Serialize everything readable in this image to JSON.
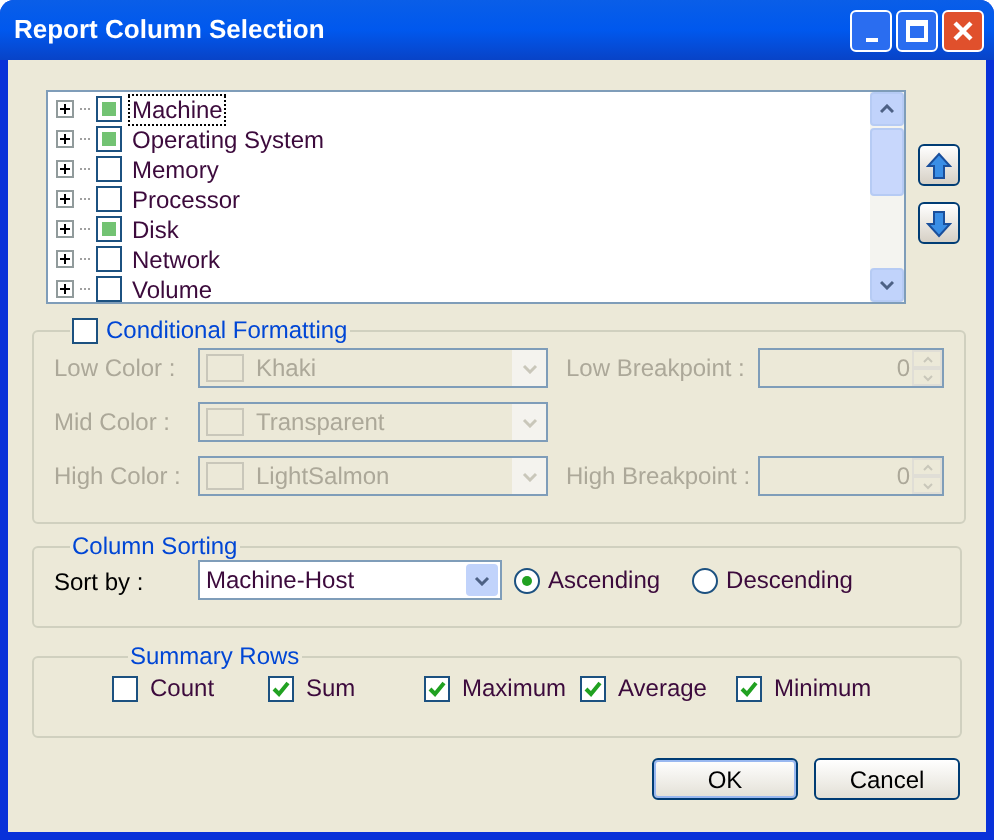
{
  "window": {
    "title": "Report Column Selection"
  },
  "tree": {
    "items": [
      {
        "label": "Machine",
        "partial": true,
        "focused": true
      },
      {
        "label": "Operating System",
        "partial": true,
        "focused": false
      },
      {
        "label": "Memory",
        "partial": false,
        "focused": false
      },
      {
        "label": "Processor",
        "partial": false,
        "focused": false
      },
      {
        "label": "Disk",
        "partial": true,
        "focused": false
      },
      {
        "label": "Network",
        "partial": false,
        "focused": false
      },
      {
        "label": "Volume",
        "partial": false,
        "focused": false
      }
    ]
  },
  "conditional_formatting": {
    "label": "Conditional Formatting",
    "checked": false,
    "colors": [
      {
        "label": "Low Color :",
        "value": "Khaki",
        "breakpoint_label": "Low Breakpoint :",
        "breakpoint": "0"
      },
      {
        "label": "Mid Color :",
        "value": "Transparent"
      },
      {
        "label": "High Color :",
        "value": "LightSalmon",
        "breakpoint_label": "High Breakpoint :",
        "breakpoint": "0"
      }
    ]
  },
  "column_sorting": {
    "title": "Column Sorting",
    "sort_by_label": "Sort by :",
    "sort_by": "Machine-Host",
    "options": [
      {
        "label": "Ascending",
        "selected": true
      },
      {
        "label": "Descending",
        "selected": false
      }
    ]
  },
  "summary_rows": {
    "title": "Summary Rows",
    "items": [
      {
        "label": "Count",
        "checked": false
      },
      {
        "label": "Sum",
        "checked": true
      },
      {
        "label": "Maximum",
        "checked": true
      },
      {
        "label": "Average",
        "checked": true
      },
      {
        "label": "Minimum",
        "checked": true
      }
    ]
  },
  "buttons": [
    "OK",
    "Cancel"
  ]
}
